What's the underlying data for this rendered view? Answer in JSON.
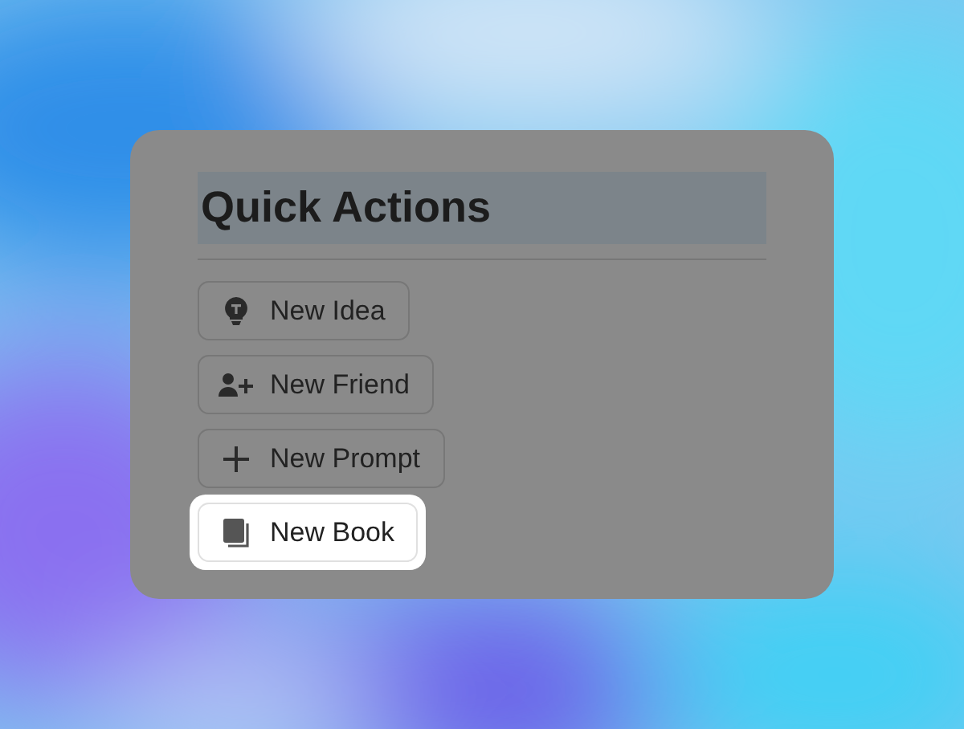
{
  "panel": {
    "title": "Quick Actions",
    "actions": [
      {
        "label": "New Idea",
        "kind": "idea",
        "selected": false
      },
      {
        "label": "New Friend",
        "kind": "friend",
        "selected": false
      },
      {
        "label": "New Prompt",
        "kind": "prompt",
        "selected": false
      },
      {
        "label": "New Book",
        "kind": "book",
        "selected": true
      }
    ]
  }
}
